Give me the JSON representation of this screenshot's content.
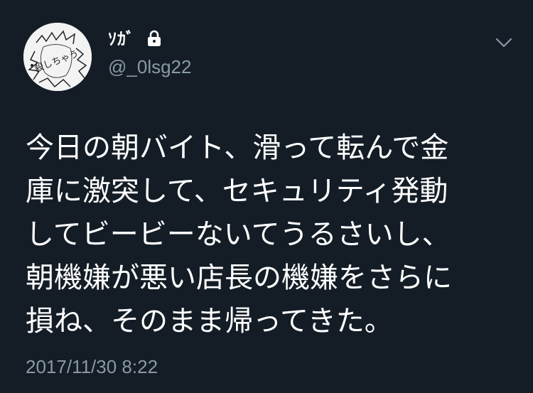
{
  "author": {
    "display_name": "ｿｶﾞ",
    "username": "@_0lsg22",
    "protected_icon": "lock-icon",
    "avatar_icon": "avatar-sketch-icon",
    "avatar_text": "殺しちゃう"
  },
  "menu": {
    "icon": "chevron-down-icon"
  },
  "tweet": {
    "lines": [
      "今日の朝バイト、滑って転んで金",
      "庫に激突して、セキュリティ発動",
      "してビービーないてうるさいし、",
      "朝機嫌が悪い店長の機嫌をさらに",
      "損ね、そのまま帰ってきた。"
    ],
    "timestamp": "2017/11/30 8:22"
  },
  "colors": {
    "background": "#141d26",
    "text": "#ffffff",
    "secondary": "#8899a6"
  }
}
